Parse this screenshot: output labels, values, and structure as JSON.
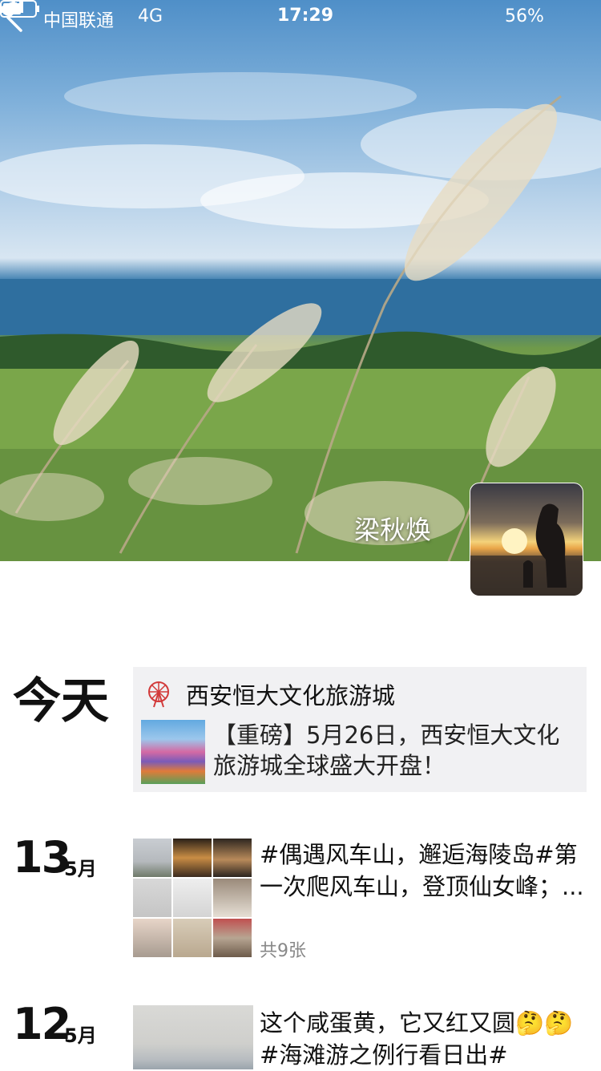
{
  "status_bar": {
    "carrier": "中国联通",
    "network": "4G",
    "time": "17:29",
    "battery": "56%"
  },
  "profile": {
    "name": "梁秋焕"
  },
  "timeline": [
    {
      "day_label": "今天",
      "share": {
        "source": "西安恒大文化旅游城",
        "text": "【重磅】5月26日，西安恒大文化旅游城全球盛大开盘！"
      }
    },
    {
      "day": "13",
      "month": "5月",
      "text": "#偶遇风车山，邂逅海陵岛#第一次爬风车山，登顶仙女峰；...",
      "count": "共9张"
    },
    {
      "day": "12",
      "month": "5月",
      "text": "这个咸蛋黄，它又红又圆🤔🤔#海滩游之例行看日出#"
    }
  ],
  "colors": {
    "share_bg": "#f1f1f3",
    "count_gray": "#888888"
  }
}
